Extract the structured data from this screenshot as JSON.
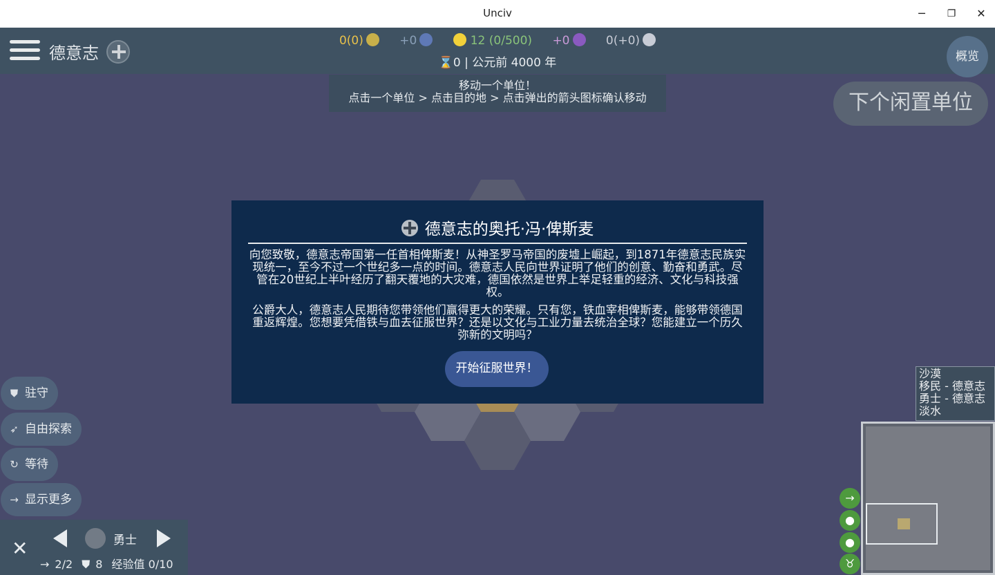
{
  "window": {
    "title": "Unciv",
    "minimize": "─",
    "restore": "❐",
    "close": "✕"
  },
  "topbar": {
    "civ_name": "德意志",
    "overview_label": "概览",
    "stats": [
      {
        "name": "gold",
        "value": "0(0)",
        "color": "#e8c14a",
        "icon_color": "#c9b04a"
      },
      {
        "name": "science",
        "value": "+0",
        "color": "#8aa0b8",
        "icon_color": "#5f79b6"
      },
      {
        "name": "happiness",
        "value": "12 (0/500)",
        "color": "#8ac47a",
        "icon_color": "#f2d13a",
        "icon_glyph": "☺"
      },
      {
        "name": "culture",
        "value": "+0",
        "color": "#c99ad8",
        "icon_color": "#8a5ac0"
      },
      {
        "name": "faith",
        "value": "0(+0)",
        "color": "#c8ccd6",
        "icon_color": "#c8ccd6"
      }
    ],
    "turn_number": "0",
    "year": "公元前 4000 年"
  },
  "instruction": {
    "line1": "移动一个单位！",
    "line2": "点击一个单位 > 点击目的地 > 点击弹出的箭头图标确认移动"
  },
  "next_unit_label": "下个闲置单位",
  "dialog": {
    "title": "德意志的奥托·冯·俾斯麦",
    "paragraph1": "向您致敬，德意志帝国第一任首相俾斯麦！从神圣罗马帝国的废墟上崛起，到1871年德意志民族实现统一，至今不过一个世纪多一点的时间。德意志人民向世界证明了他们的创意、勤奋和勇武。尽管在20世纪上半叶经历了翻天覆地的大灾难，德国依然是世界上举足轻重的经济、文化与科技强权。",
    "paragraph2": "公爵大人，德意志人民期待您带领他们赢得更大的荣耀。只有您，铁血宰相俾斯麦，能够带领德国重返辉煌。您想要凭借铁与血去征服世界？还是以文化与工业力量去统治全球？您能建立一个历久弥新的文明吗？",
    "button_label": "开始征服世界！"
  },
  "actions": [
    {
      "label": "驻守",
      "icon": "shield-icon",
      "glyph": "⛊"
    },
    {
      "label": "自由探索",
      "icon": "explore-icon",
      "glyph": "➶"
    },
    {
      "label": "等待",
      "icon": "wait-icon",
      "glyph": "↻"
    },
    {
      "label": "显示更多",
      "icon": "arrow-right-icon",
      "glyph": "→"
    }
  ],
  "unit": {
    "name": "勇士",
    "movement": "2/2",
    "strength": "8",
    "experience": "经验值 0/10"
  },
  "tile_info": [
    "沙漠",
    "移民 - 德意志",
    "勇士 - 德意志",
    "淡水"
  ],
  "minimap_buttons": [
    {
      "icon": "movement-overlay-icon",
      "glyph": "→"
    },
    {
      "icon": "food-overlay-icon",
      "glyph": "●"
    },
    {
      "icon": "population-overlay-icon",
      "glyph": "●"
    },
    {
      "icon": "resource-overlay-icon",
      "glyph": "♉"
    }
  ]
}
